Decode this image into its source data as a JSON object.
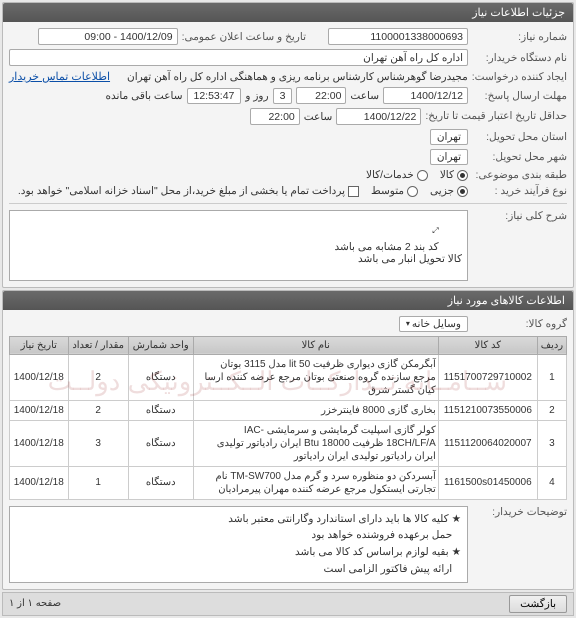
{
  "panels": {
    "info_header": "جزئیات اطلاعات نیاز",
    "items_header": "اطلاعات کالاهای مورد نیاز"
  },
  "form": {
    "need_no_label": "شماره نیاز:",
    "need_no": "1100001338000693",
    "announce_label": "تاریخ و ساعت اعلان عمومی:",
    "announce_date": "1400/12/09 - 09:00",
    "buyer_org_label": "نام دستگاه خریدار:",
    "buyer_org": "اداره کل راه آهن تهران",
    "requester_label": "ایجاد کننده درخواست:",
    "requester": "مجیدرضا گوهرشناس کارشناس برنامه ریزی و هماهنگی اداره کل راه آهن تهران",
    "contact_link": "اطلاعات تماس خریدار",
    "deadline_label": "مهلت ارسال پاسخ:",
    "deadline_date": "1400/12/12",
    "hour_word": "ساعت",
    "deadline_time": "22:00",
    "day_word": "روز و",
    "remaining_days": "3",
    "remaining_time": "12:53:47",
    "remaining_suffix": "ساعت باقی مانده",
    "valid_label": "حداقل تاریخ اعتبار قیمت تا تاریخ:",
    "valid_date": "1400/12/22",
    "valid_time": "22:00",
    "req_city_label": "استان محل تحویل:",
    "req_city": "تهران",
    "del_city_label": "شهر محل تحویل:",
    "del_city": "تهران",
    "category_label": "طبقه بندی موضوعی:",
    "cat_goods": "کالا",
    "cat_services": "خدمات/کالا",
    "purchase_type_label": "نوع فرآیند خرید :",
    "pt_small": "جزیی",
    "pt_medium": "متوسط",
    "pt_note": "پرداخت تمام یا بخشی از مبلغ خرید،از محل \"اسناد خزانه اسلامی\" خواهد بود.",
    "desc_label": "شرح کلی نیاز:",
    "desc_text": "کد بند 2 مشابه می باشد\nکالا تحویل انبار می باشد",
    "group_label": "گروه کالا:",
    "group_value": "وسایل خانه",
    "buyer_notes_label": "توضیحات خریدار:",
    "notes_b1": "کلیه کالا ها باید دارای استاندارد وگارانتی معتبر باشد",
    "notes_b2": "حمل برعهده فروشنده خواهد بود",
    "notes_b3": "بقیه لوازم براساس کد کالا می باشد",
    "notes_b4": "ارائه پیش فاکتور الزامی است"
  },
  "table": {
    "headers": {
      "row": "ردیف",
      "code": "کد کالا",
      "name": "نام کالا",
      "unit": "واحد شمارش",
      "qty": "مقدار / تعداد",
      "date": "تاریخ نیاز"
    },
    "rows": [
      {
        "idx": "1",
        "code": "1151700729710002",
        "name": "آبگرمکن گازی دیواری ظرفیت 50 lit مدل 3115 بوتان مرجع سازنده گروه صنعتی بوتان مرجع عرضه کننده ارسا کیان گستر شرق",
        "unit": "دستگاه",
        "qty": "2",
        "date": "1400/12/18"
      },
      {
        "idx": "2",
        "code": "1151210073550006",
        "name": "بخاری گازی 8000 فاینترخزر",
        "unit": "دستگاه",
        "qty": "2",
        "date": "1400/12/18"
      },
      {
        "idx": "3",
        "code": "1151120064020007",
        "name": "کولر گازی اسپلیت گرمایشی و سرمایشی IAC-18CH/LF/A ظرفیت Btu 18000 ایران رادیاتور تولیدی ایران رادیاتور تولیدی ایران رادیاتور",
        "unit": "دستگاه",
        "qty": "3",
        "date": "1400/12/18"
      },
      {
        "idx": "4",
        "code": "1161500s01450006",
        "name": "آبسردکن دو منظوره سرد و گرم مدل TM-SW700 نام تجارتی ایستکول مرجع عرضه کننده مهران پیرمرادیان",
        "unit": "دستگاه",
        "qty": "1",
        "date": "1400/12/18"
      }
    ]
  },
  "footer": {
    "back": "بازگشت",
    "pager": "صفحه ۱ از ۱"
  }
}
